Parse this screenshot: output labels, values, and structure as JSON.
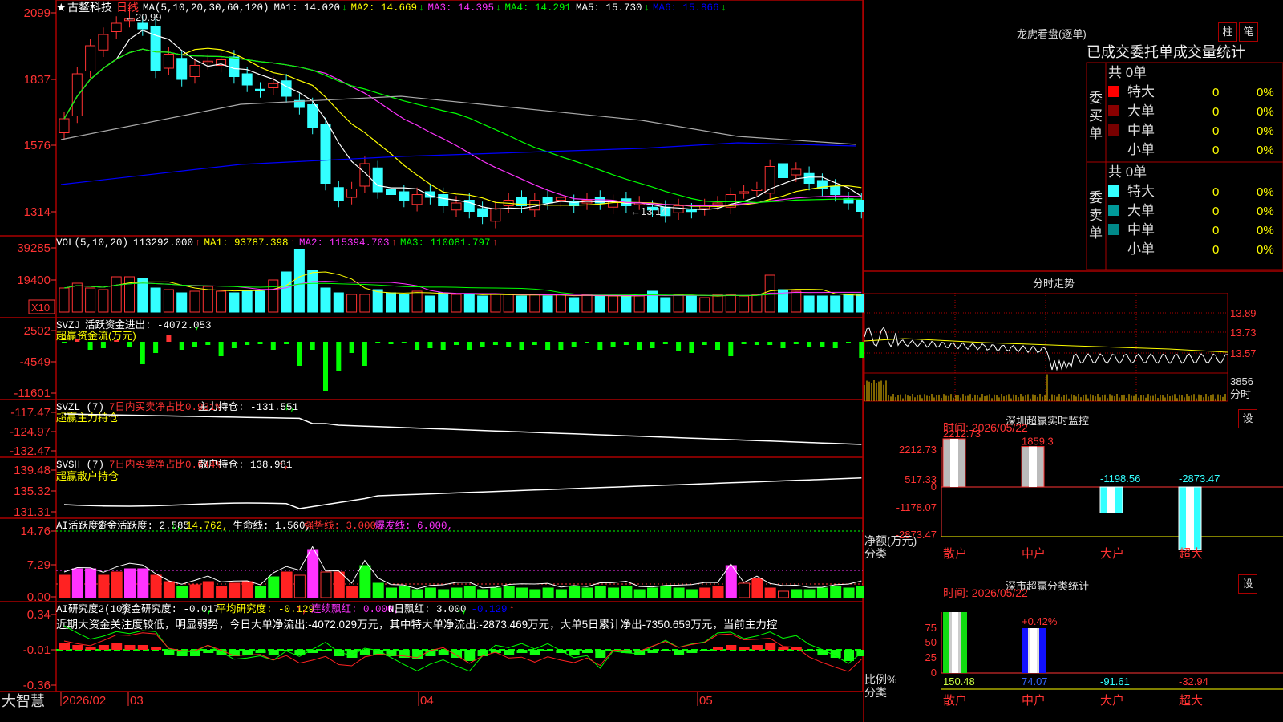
{
  "app_name": "大智慧",
  "stock": {
    "star": "★",
    "name": "古鳌科技",
    "period": "日线"
  },
  "colors": {
    "up": "#ff3333",
    "down": "#33ffff",
    "bg": "#000000",
    "frame": "#aa0000",
    "ma1": "#ffffff",
    "ma2": "#ffff00",
    "ma3": "#ff33ff",
    "ma4": "#00ff00",
    "ma5": "#aaaaaa",
    "ma6": "#0000ff"
  },
  "k_panel": {
    "legend": [
      {
        "text": "MA(5,10,20,30,60,120)",
        "color": "#ffffff"
      },
      {
        "text": "MA1: 14.020",
        "arrow": "↓",
        "color": "#ffffff"
      },
      {
        "text": "MA2: 14.669",
        "arrow": "↓",
        "color": "#ffff00"
      },
      {
        "text": "MA3: 14.395",
        "arrow": "↓",
        "color": "#ff33ff"
      },
      {
        "text": "MA4: 14.291",
        "arrow": "",
        "color": "#00ff00"
      },
      {
        "text": "MA5: 15.730",
        "arrow": "↓",
        "color": "#ffffff"
      },
      {
        "text": "MA6: 15.866",
        "arrow": "↓",
        "color": "#0000ff"
      }
    ],
    "y_ticks": [
      "2099",
      "1837",
      "1576",
      "1314"
    ],
    "high_label": "20.99",
    "low_label": "13.14"
  },
  "vol_panel": {
    "legend": [
      {
        "text": "VOL(5,10,20)",
        "color": "#ffffff"
      },
      {
        "text": "113292.000",
        "arrow": "↑",
        "color": "#ffffff"
      },
      {
        "text": "MA1: 93787.398",
        "arrow": "↑",
        "color": "#ffff00"
      },
      {
        "text": "MA2: 115394.703",
        "arrow": "↑",
        "color": "#ff33ff"
      },
      {
        "text": "MA3: 110081.797",
        "arrow": "↑",
        "color": "#00ff00"
      }
    ],
    "y_ticks": [
      "39285",
      "19400"
    ],
    "unit": "X10"
  },
  "svzj_panel": {
    "legend": [
      {
        "text": "SVZJ",
        "color": "#ffffff"
      },
      {
        "text": "活跃资金进出: -4072.053",
        "arrow": "↓,",
        "color": "#ffffff"
      }
    ],
    "sub_label": "超赢资金流(万元)",
    "y_ticks": [
      "2502",
      "-4549",
      "-11601"
    ]
  },
  "svzl_panel": {
    "legend": [
      {
        "text": "SVZL (7)",
        "color": "#ffffff"
      },
      {
        "text": "7日内买卖净占比0.931%",
        "color": "#ff3333"
      },
      {
        "text": "主力持仓: -131.551",
        "arrow": "↓,",
        "color": "#ffffff"
      }
    ],
    "sub_label": "超赢主力持仓",
    "y_ticks": [
      "-117.47",
      "-124.97",
      "-132.47"
    ]
  },
  "svsh_panel": {
    "legend": [
      {
        "text": "SVSH (7)",
        "color": "#ffffff"
      },
      {
        "text": "7日内买卖净占比0.644%",
        "color": "#ff3333"
      },
      {
        "text": "散户持仓: 138.981",
        "arrow": "↑,",
        "color": "#ffffff"
      }
    ],
    "sub_label": "超赢散户持仓",
    "y_ticks": [
      "139.48",
      "135.32",
      "131.31"
    ]
  },
  "ai_panel": {
    "legend": [
      {
        "text": "AI活跃度2",
        "color": "#ffffff"
      },
      {
        "text": "资金活跃度: 2.585",
        "arrow": "↓,",
        "color": "#ffffff"
      },
      {
        "text": "14.762,",
        "color": "#ffff00"
      },
      {
        "text": "生命线: 1.560,",
        "color": "#ffffff"
      },
      {
        "text": "强势线: 3.000,",
        "color": "#ff3333"
      },
      {
        "text": "爆发线: 6.000,",
        "color": "#ff33ff"
      }
    ],
    "y_ticks": [
      "14.76",
      "7.29",
      "0.00"
    ]
  },
  "yjd_panel": {
    "legend": [
      {
        "text": "AI研究度2(10)",
        "color": "#ffffff"
      },
      {
        "text": "资金研究度: -0.017",
        "arrow": "↓,",
        "color": "#ffffff"
      },
      {
        "text": "平均研究度: -0.129",
        "arrow": "↑,",
        "color": "#ffff00"
      },
      {
        "text": "连续飘红: 0.000,",
        "color": "#ff33ff"
      },
      {
        "text": "N日飘红: 3.000",
        "arrow": "↓,",
        "color": "#ffffff"
      },
      {
        "text": "-0.129",
        "arrow": "↑",
        "color": "#0000ff"
      }
    ],
    "comment": "近期大资金关注度较低，明显弱势，今日大单净流出:-4072.029万元，其中特大单净流出:-2873.469万元，大单5日累计净出-7350.659万元，当前主力控",
    "y_ticks": [
      "0.34",
      "-0.01",
      "-0.36"
    ]
  },
  "x_axis": {
    "labels": [
      "2026/02",
      "03",
      "04",
      "05"
    ]
  },
  "longhu": {
    "title": "龙虎看盘(逐单)",
    "btn_zhu": "柱",
    "btn_bi": "笔",
    "header": "已成交委托单成交量统计",
    "buy": {
      "side_label": "委买单",
      "total": "共 0单",
      "rows": [
        {
          "label": "特大",
          "color": "#ff0000",
          "count": "0",
          "pct": "0%"
        },
        {
          "label": "大单",
          "color": "#880000",
          "count": "0",
          "pct": "0%"
        },
        {
          "label": "中单",
          "color": "#770000",
          "count": "0",
          "pct": "0%"
        },
        {
          "label": "小单",
          "color": "",
          "count": "0",
          "pct": "0%"
        }
      ]
    },
    "sell": {
      "side_label": "委卖单",
      "total": "共 0单",
      "rows": [
        {
          "label": "特大",
          "color": "#33ffff",
          "count": "0",
          "pct": "0%"
        },
        {
          "label": "大单",
          "color": "#009999",
          "count": "0",
          "pct": "0%"
        },
        {
          "label": "中单",
          "color": "#008888",
          "count": "0",
          "pct": "0%"
        },
        {
          "label": "小单",
          "color": "",
          "count": "0",
          "pct": "0%"
        }
      ]
    }
  },
  "fenshi": {
    "title": "分时走势",
    "y_ticks": [
      "13.89",
      "13.73",
      "13.57"
    ],
    "vol_tick": "3856",
    "vol_label": "分时"
  },
  "sz_monitor": {
    "title": "深圳超赢实时监控",
    "set_btn": "设",
    "time_label": "时间: 2026/05/22",
    "y_ticks": [
      "2212.73",
      "517.33",
      "0",
      "-1178.07",
      "-2873.47"
    ],
    "axis_label1": "净额(万元)",
    "axis_label2": "分类",
    "cats": [
      "散户",
      "中户",
      "大户",
      "超大"
    ],
    "values": [
      2212.73,
      1859.3,
      -1198.56,
      -2873.47
    ],
    "value_labels": [
      "2212.73",
      "1859.3",
      "-1198.56",
      "-2873.47"
    ]
  },
  "sz_stats": {
    "title": "深市超赢分类统计",
    "set_btn": "设",
    "time_label": "时间: 2026/05/22",
    "y_ticks": [
      "75",
      "50",
      "25",
      "0"
    ],
    "axis_label1": "比例%",
    "axis_label2": "分类",
    "pct_label": "+0.42%",
    "cats": [
      "散户",
      "中户",
      "大户",
      "超大"
    ],
    "values": [
      "150.48",
      "74.07",
      "-91.61",
      "-32.94"
    ]
  }
}
